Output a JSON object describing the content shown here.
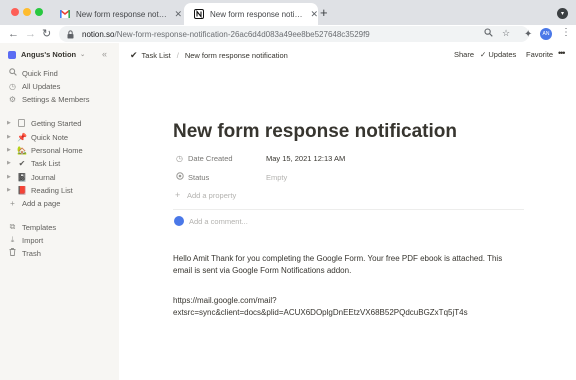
{
  "browser": {
    "tabs": [
      {
        "title": "New form response notification",
        "favicon": "gmail-icon",
        "active": false
      },
      {
        "title": "New form response notification",
        "favicon": "notion-icon",
        "active": true
      }
    ],
    "new_tab_glyph": "+",
    "address": {
      "host": "notion.so",
      "path": "/New-form-response-notification-26ac6d4d083a49ee8be527648c3529f9"
    },
    "profile_initials": "AN"
  },
  "sidebar": {
    "workspace": "Angus's Notion",
    "top_items": [
      {
        "label": "Quick Find",
        "icon": "search-icon"
      },
      {
        "label": "All Updates",
        "icon": "clock-icon"
      },
      {
        "label": "Settings & Members",
        "icon": "gear-icon"
      }
    ],
    "pages": [
      {
        "label": "Getting Started",
        "icon": "document-icon"
      },
      {
        "label": "Quick Note",
        "icon": "pushpin-icon"
      },
      {
        "label": "Personal Home",
        "icon": "house-icon"
      },
      {
        "label": "Task List",
        "icon": "checkmark-icon"
      },
      {
        "label": "Journal",
        "icon": "notebook-icon"
      },
      {
        "label": "Reading List",
        "icon": "book-icon"
      }
    ],
    "add_page": "Add a page",
    "bottom_items": [
      {
        "label": "Templates",
        "icon": "templates-icon"
      },
      {
        "label": "Import",
        "icon": "download-icon"
      },
      {
        "label": "Trash",
        "icon": "trash-icon"
      }
    ]
  },
  "topbar": {
    "breadcrumb": [
      "Task List",
      "New form response notification"
    ],
    "share": "Share",
    "updates": "Updates",
    "favorite": "Favorite",
    "more": "•••"
  },
  "page": {
    "title": "New form response notification",
    "properties": [
      {
        "name": "Date Created",
        "value": "May 15, 2021 12:13 AM",
        "icon": "clock-icon"
      },
      {
        "name": "Status",
        "value": "Empty",
        "icon": "status-icon"
      }
    ],
    "add_property": "Add a property",
    "comment_placeholder": "Add a comment...",
    "body": [
      "Hello Amit Thank for you completing the Google Form. Your free PDF ebook is attached. This",
      "email is sent via Google Form Notifications addon.",
      "https://mail.google.com/mail?",
      "extsrc=sync&client=docs&plid=ACUX6DOplgDnEEtzVX68B52PQdcuBGZxTq5jT4s"
    ]
  },
  "colors": {
    "sidebar_bg": "#f7f6f3",
    "text": "#37352f",
    "muted": "#9b9a97",
    "accent": "#4a78e8"
  }
}
